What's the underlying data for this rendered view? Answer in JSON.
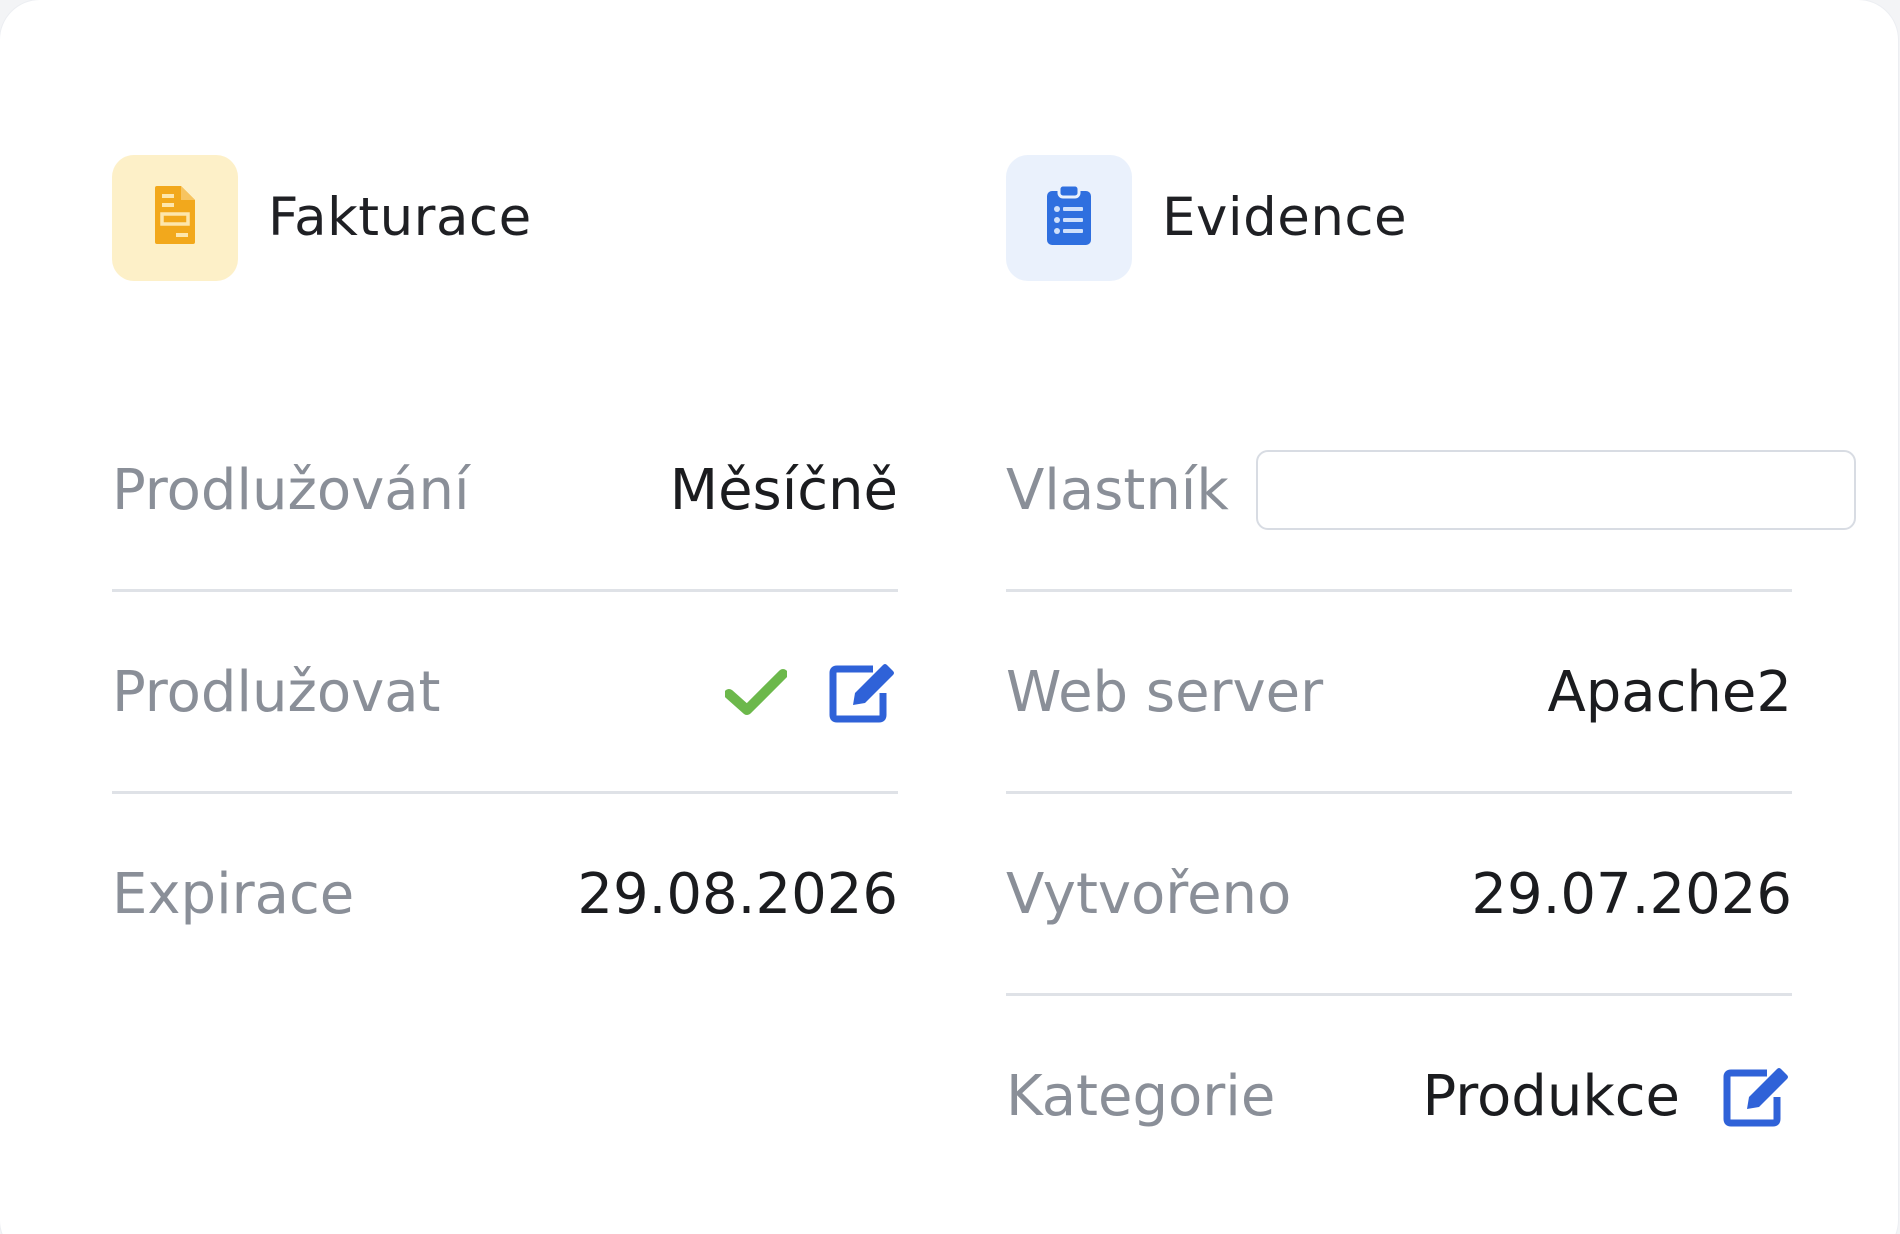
{
  "billing": {
    "title": "Fakturace",
    "icon": "document-icon",
    "accent": "#f2a81c",
    "rows": {
      "renewal_period": {
        "label": "Prodlužování",
        "value": "Měsíčně"
      },
      "auto_renew": {
        "label": "Prodlužovat",
        "checked": true
      },
      "expiration": {
        "label": "Expirace",
        "value": "29.08.2026"
      }
    }
  },
  "records": {
    "title": "Evidence",
    "icon": "clipboard-list-icon",
    "accent": "#2f6fdf",
    "rows": {
      "owner": {
        "label": "Vlastník",
        "value": "",
        "placeholder": ""
      },
      "web_server": {
        "label": "Web server",
        "value": "Apache2"
      },
      "created": {
        "label": "Vytvořeno",
        "value": "29.07.2026"
      },
      "category": {
        "label": "Kategorie",
        "value": "Produkce"
      }
    }
  },
  "colors": {
    "label": "#8a8f98",
    "value": "#1b1c1f",
    "divider": "#dfe2e7",
    "edit": "#2f62d8",
    "check": "#6cb84b"
  }
}
